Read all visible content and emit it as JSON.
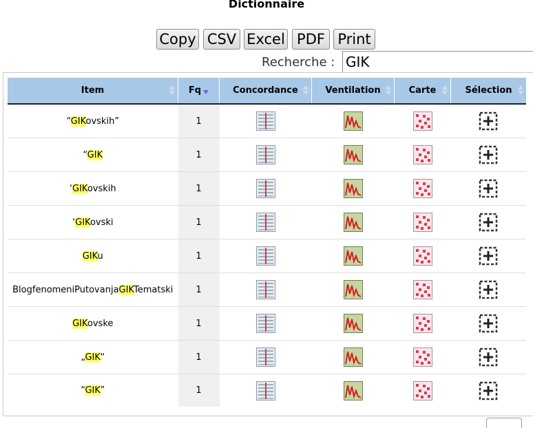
{
  "page_title": "Dictionnaire",
  "export_buttons": [
    "Copy",
    "CSV",
    "Excel",
    "PDF",
    "Print"
  ],
  "search": {
    "label": "Recherche :",
    "value": "GIK"
  },
  "columns": [
    "Item",
    "Fq",
    "Concordance",
    "Ventilation",
    "Carte",
    "Sélection"
  ],
  "sort": {
    "column": "Fq",
    "direction": "descending"
  },
  "highlight": "GIK",
  "colors": {
    "header_bg": "#a8c8e8",
    "highlight": "#ffff66",
    "fq_bg": "#f0f0f0"
  },
  "icons": {
    "concordance": "concordance-icon",
    "ventilation": "ventilation-chart-icon",
    "carte": "map-grid-icon",
    "selection": "add-selection-icon"
  },
  "rows": [
    {
      "item_pre": "“",
      "item_match": "GIK",
      "item_post": "ovskih”",
      "fq": "1"
    },
    {
      "item_pre": "“",
      "item_match": "GIK",
      "item_post": "",
      "fq": "1"
    },
    {
      "item_pre": "‘",
      "item_match": "GIK",
      "item_post": "ovskih",
      "fq": "1"
    },
    {
      "item_pre": "‘",
      "item_match": "GIK",
      "item_post": "ovski",
      "fq": "1"
    },
    {
      "item_pre": "",
      "item_match": "GIK",
      "item_post": "u",
      "fq": "1"
    },
    {
      "item_pre": "BlogfenomeniPutovanja",
      "item_match": "GIK",
      "item_post": "Tematski",
      "fq": "1"
    },
    {
      "item_pre": "",
      "item_match": "GIK",
      "item_post": "ovske",
      "fq": "1"
    },
    {
      "item_pre": "„",
      "item_match": "GIK",
      "item_post": "“",
      "fq": "1"
    },
    {
      "item_pre": "“",
      "item_match": "GIK",
      "item_post": "”",
      "fq": "1"
    }
  ]
}
